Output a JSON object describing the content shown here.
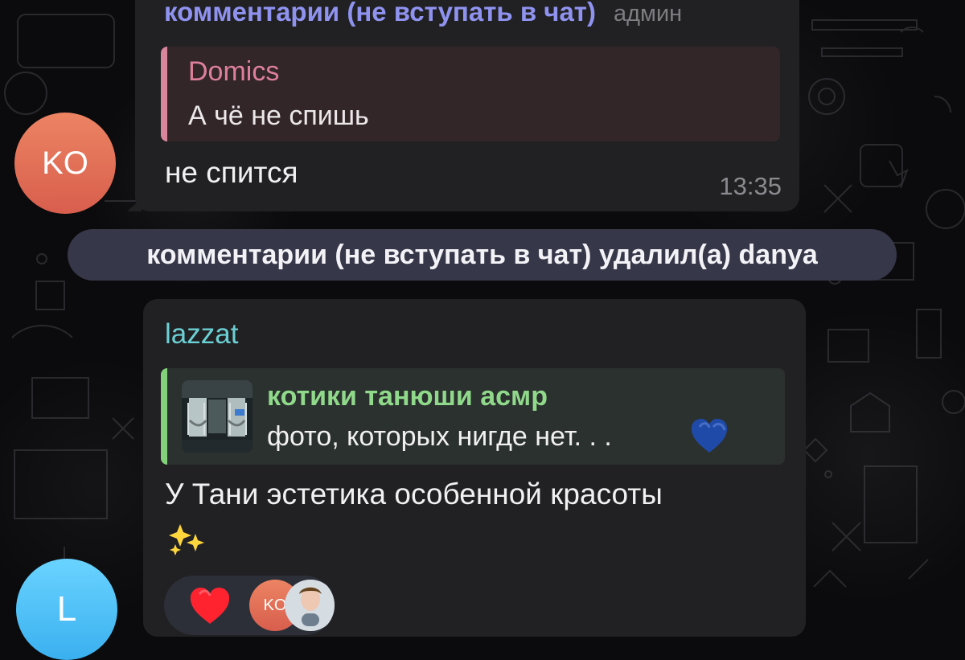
{
  "chat": {
    "top_message": {
      "sender_name": "комментарии (не вступать в чат)",
      "sender_role": "админ",
      "reply": {
        "author": "Domics",
        "text": "А чё не спишь"
      },
      "text": "не спится",
      "time": "13:35",
      "avatar_text": "KO"
    },
    "service_message": {
      "text": "комментарии (не вступать в чат) удалил(а) danya"
    },
    "bottom_message": {
      "sender_name": "lazzat",
      "reply": {
        "author": "котики танюши асмр",
        "text": "фото, которых нигде нет. . ."
      },
      "text": "У Тани эстетика особенной красоты",
      "avatar_text": "L",
      "reaction": {
        "icon": "red-heart",
        "avatar_text": "KO"
      }
    }
  },
  "colors": {
    "background": "#0b0b0d",
    "bubble": "#212124",
    "service_pill": "#37374a",
    "sender_name_top": "#8f93ef",
    "reply_author_pink": "#de7f9c",
    "sender_name_bottom": "#6bd0d4",
    "reply_author_green": "#90d98b",
    "avatar_ko": "#e46f55",
    "avatar_l": "#4bc1f5"
  }
}
